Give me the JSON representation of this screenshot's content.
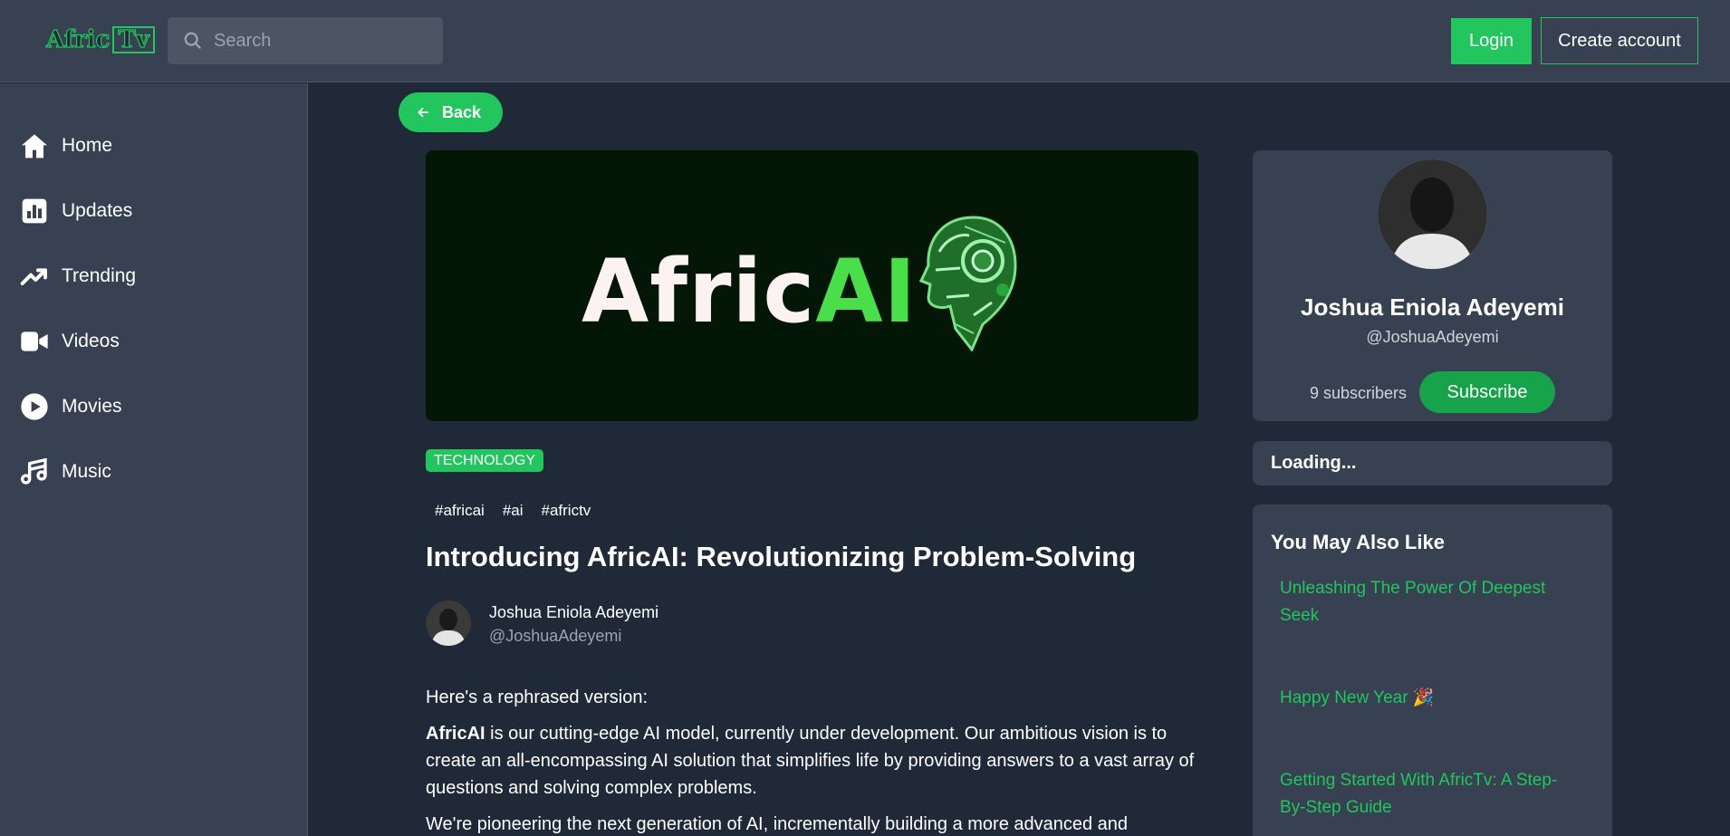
{
  "header": {
    "logo_part1": "Afric",
    "logo_part2": "Tv",
    "search_placeholder": "Search",
    "login_label": "Login",
    "create_account_label": "Create account"
  },
  "sidebar": {
    "items": [
      {
        "label": "Home",
        "icon": "home-icon"
      },
      {
        "label": "Updates",
        "icon": "chart-icon"
      },
      {
        "label": "Trending",
        "icon": "trending-icon"
      },
      {
        "label": "Videos",
        "icon": "video-icon"
      },
      {
        "label": "Movies",
        "icon": "play-icon"
      },
      {
        "label": "Music",
        "icon": "music-icon"
      }
    ]
  },
  "main": {
    "back_label": "Back",
    "hero": {
      "text_white": "Afric",
      "text_green": "AI"
    },
    "category": "TECHNOLOGY",
    "hashtags": [
      "#africai",
      "#ai",
      "#africtv"
    ],
    "title": "Introducing AfricAI: Revolutionizing Problem-Solving",
    "author": {
      "name": "Joshua Eniola Adeyemi",
      "handle": "@JoshuaAdeyemi"
    },
    "body": {
      "intro": "Here's a rephrased version:",
      "p1_bold": "AfricAI",
      "p1_line1": " is our cutting-edge AI model, currently under development. Our ambitious vision is to",
      "p1_line2": "create an all-encompassing AI solution that simplifies life by providing answers to a vast array of",
      "p1_line3": "questions and solving complex problems.",
      "p2_line1": "We're pioneering the next generation of AI, incrementally building a more advanced and"
    }
  },
  "profile": {
    "name": "Joshua Eniola Adeyemi",
    "handle": "@JoshuaAdeyemi",
    "subscribers": "9 subscribers",
    "subscribe_label": "Subscribe"
  },
  "loading_text": "Loading...",
  "related": {
    "title": "You May Also Like",
    "items": [
      {
        "line1": "Unleashing The Power Of Deepest",
        "line2": "Seek"
      },
      {
        "line1": "Happy New Year 🎉",
        "line2": ""
      },
      {
        "line1": "Getting Started With AfricTv: A Step-",
        "line2": "By-Step Guide"
      }
    ]
  },
  "colors": {
    "accent": "#22c55e",
    "header_bg": "#374151",
    "page_bg": "#1f2937"
  }
}
